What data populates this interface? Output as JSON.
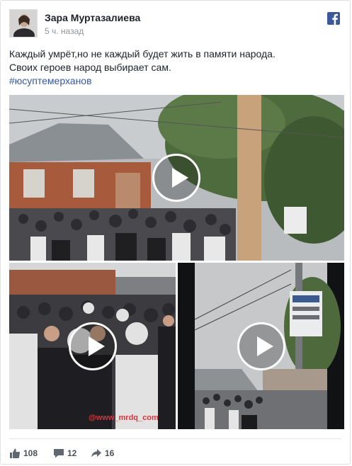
{
  "post": {
    "author": "Зара Муртазалиева",
    "time": "5 ч. назад",
    "text_lines": [
      "Каждый умрёт,но не каждый будет жить в памяти народа.",
      "Своих героев народ выбирает сам."
    ],
    "hashtag": "#юсуптемерханов",
    "network_icon": "facebook-icon"
  },
  "media": {
    "watermark": "@www_mrdq_com"
  },
  "stats": {
    "likes": "108",
    "comments": "12",
    "shares": "16"
  },
  "colors": {
    "link": "#365899",
    "facebook_blue": "#3b5998",
    "meta_text": "#90949c"
  }
}
